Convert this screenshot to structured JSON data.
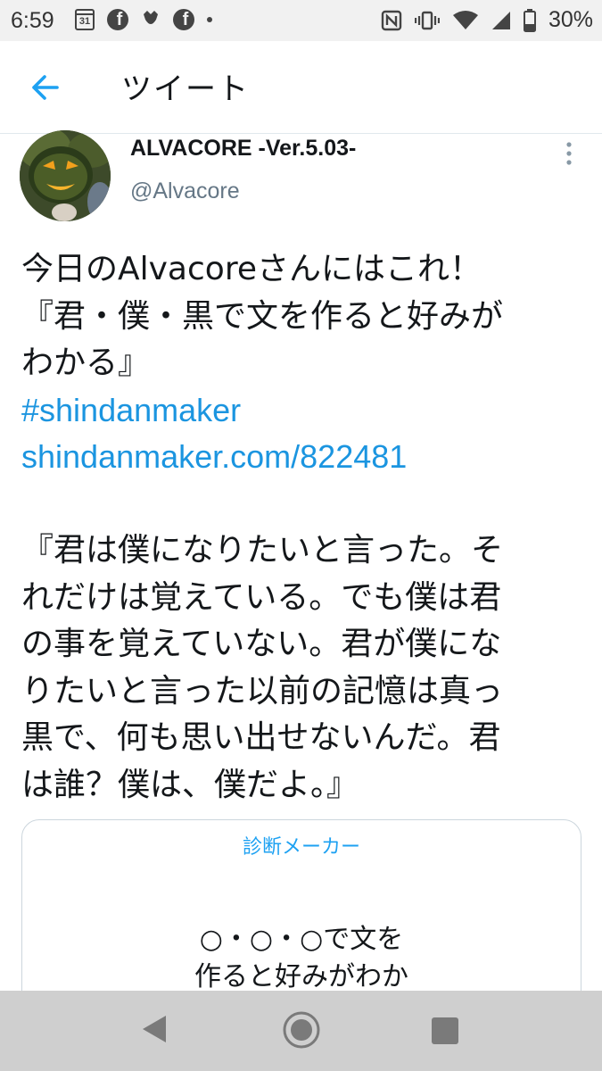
{
  "status_bar": {
    "time": "6:59",
    "calendar_day": "31",
    "battery": "30%"
  },
  "header": {
    "title": "ツイート"
  },
  "tweet": {
    "display_name": "ALVACORE -Ver.5.03-",
    "handle": "@Alvacore",
    "body_lines": [
      "今日のAlvacoreさんにはこれ！",
      "『君・僕・黒で文を作ると好みが",
      "わかる』"
    ],
    "hashtag": "#shindanmaker",
    "link": "shindanmaker.com/822481",
    "quote_lines": [
      "『君は僕になりたいと言った。そ",
      "れだけは覚えている。でも僕は君",
      "の事を覚えていない。君が僕にな",
      "りたいと言った以前の記憶は真っ",
      "黒で、何も思い出せないんだ。君",
      "は誰？僕は、僕だよ。』"
    ]
  },
  "card": {
    "brand": "診断メーカー",
    "title_lines": [
      "○・○・○で文を",
      "作ると好みがわか"
    ]
  },
  "colors": {
    "link": "#1b95e0",
    "accent": "#1da1f2",
    "text": "#14171a",
    "secondary": "#657786"
  }
}
